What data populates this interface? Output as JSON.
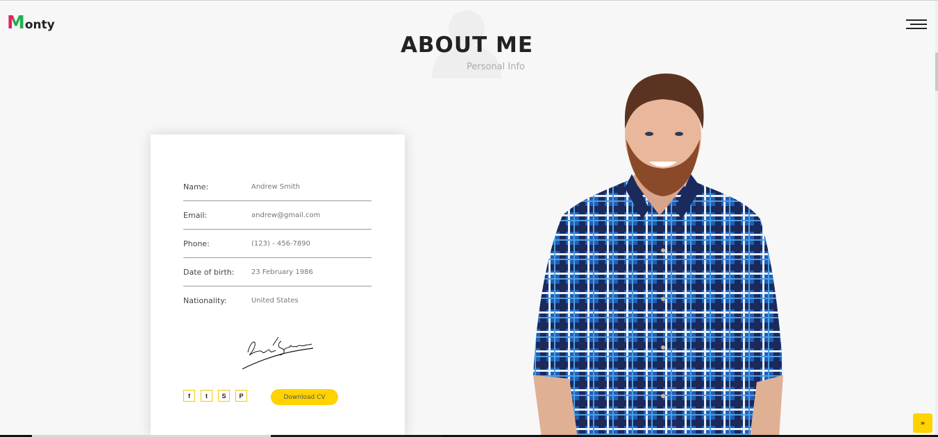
{
  "brand": {
    "logo_initial": "M",
    "logo_rest": "onty"
  },
  "section": {
    "title": "ABOUT ME",
    "subtitle": "Personal Info"
  },
  "info": [
    {
      "label": "Name:",
      "value": "Andrew Smith"
    },
    {
      "label": "Email:",
      "value": "andrew@gmail.com"
    },
    {
      "label": "Phone:",
      "value": "(123) - 456-7890"
    },
    {
      "label": "Date of birth:",
      "value": "23 February 1986"
    },
    {
      "label": "Nationality:",
      "value": "United States"
    }
  ],
  "social": [
    {
      "icon": "facebook-icon",
      "glyph": "f"
    },
    {
      "icon": "twitter-icon",
      "glyph": "t"
    },
    {
      "icon": "skype-icon",
      "glyph": "S"
    },
    {
      "icon": "pinterest-icon",
      "glyph": "P"
    }
  ],
  "cv_button": "Download CV",
  "back_to_top_glyph": "»",
  "colors": {
    "accent": "#ffd200",
    "background": "#f7f7f7",
    "card": "#ffffff",
    "title": "#222222"
  }
}
